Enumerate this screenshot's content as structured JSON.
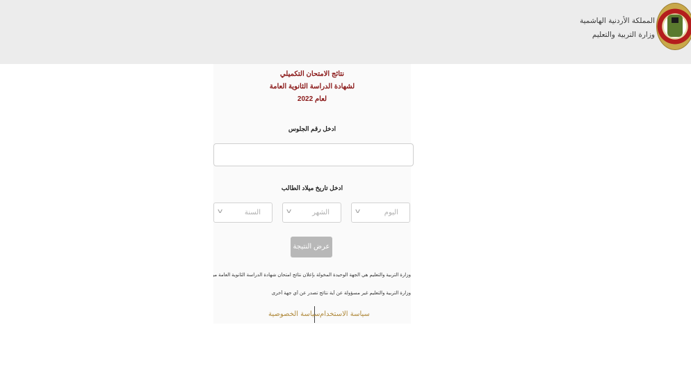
{
  "header": {
    "kingdom": "المملكة الأردنية الهاشمية",
    "ministry": "وزارة التربية والتعليم"
  },
  "form": {
    "title_line1": "نتائج الامتحان التكميلي",
    "title_line2": "لشهادة الدراسة الثانوية العامة",
    "title_line3": "لعام 2022",
    "seat_label": "ادخل رقم الجلوس",
    "seat_value": "",
    "dob_label": "ادخل تاريخ ميلاد الطالب",
    "day_placeholder": "اليوم",
    "month_placeholder": "الشهر",
    "year_placeholder": "السنة",
    "submit_label": "عرض النتيجة",
    "notice_1": "وزارة التربية والتعليم هي الجهة الوحيدة المخولة بإعلان نتائج امتحان شهادة الدراسة الثانوية العامة من هذا الموقع",
    "notice_2": "وزارة التربية والتعليم غير مسؤولة عن أية نتائج تصدر عن أي جهة أخرى"
  },
  "footer": {
    "terms": "سياسة الاستخدام",
    "privacy": "سياسة الخصوصية"
  },
  "colors": {
    "title": "#8b1a1a",
    "link": "#b08a3c",
    "header_bg": "#ececec",
    "button_bg": "#b8b8b8"
  }
}
